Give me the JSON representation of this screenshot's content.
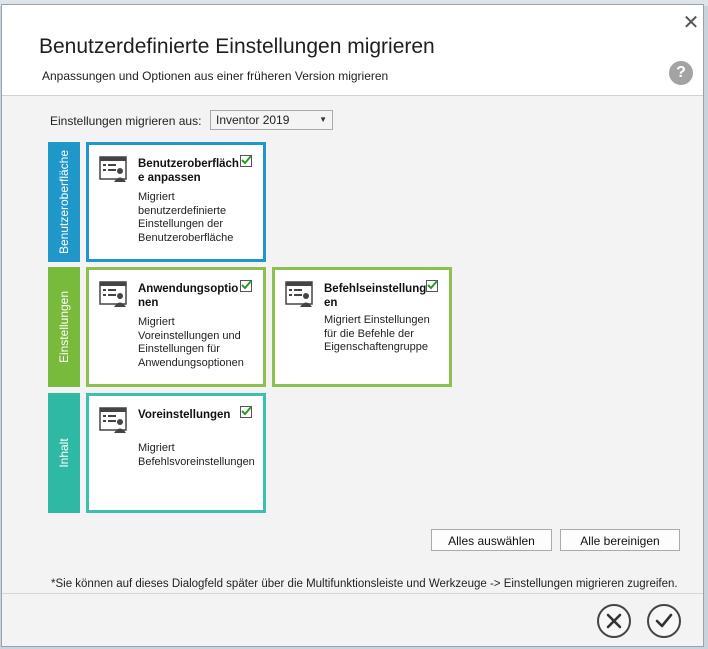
{
  "dialog": {
    "title": "Benutzerdefinierte Einstellungen migrieren",
    "subtitle": "Anpassungen und Optionen aus einer früheren Version migrieren",
    "help_label": "?"
  },
  "migrate_from": {
    "label": "Einstellungen migrieren aus:",
    "selected": "Inventor 2019"
  },
  "categories": [
    {
      "label": "Benutzeroberfläche",
      "color": "#1f97c9"
    },
    {
      "label": "Einstellungen",
      "color": "#78ba3c"
    },
    {
      "label": "Inhalt",
      "color": "#2fb9a5"
    }
  ],
  "cards": [
    {
      "title": "Benutzeroberfläche anpassen",
      "desc": "Migriert benutzerdefinierte Einstellungen der Benutzeroberfläche",
      "checked": true
    },
    {
      "title": "Anwendungsoptionen",
      "desc": "Migriert Voreinstellungen und Einstellungen für Anwendungsoptionen",
      "checked": true
    },
    {
      "title": "Befehlseinstellungen",
      "desc": "Migriert Einstellungen für die Befehle der Eigenschaftengruppe",
      "checked": true
    },
    {
      "title": "Voreinstellungen",
      "desc": "Migriert Befehlsvoreinstellungen",
      "checked": true
    }
  ],
  "buttons": {
    "select_all": "Alles auswählen",
    "clear_all": "Alle bereinigen"
  },
  "footnote": "*Sie können auf dieses Dialogfeld später über die Multifunktionsleiste und Werkzeuge -> Einstellungen migrieren zugreifen.",
  "colors": {
    "check": "#2a9a2a",
    "ui_border": "#1f97c9",
    "settings_border": "#8cc151",
    "content_border": "#3bbfb0"
  }
}
